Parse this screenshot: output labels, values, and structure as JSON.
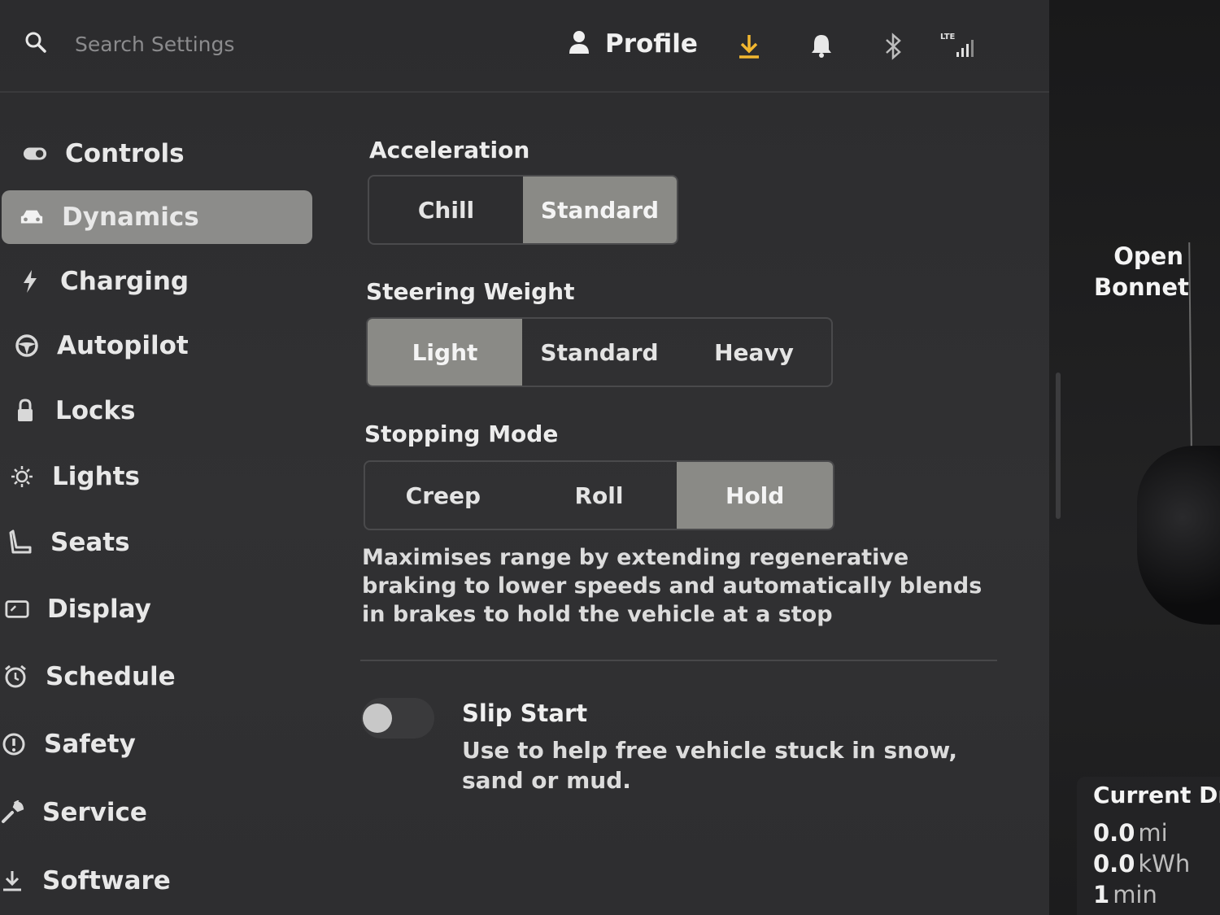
{
  "topbar": {
    "search_placeholder": "Search Settings",
    "profile_label": "Profile",
    "download_color": "#f2b730",
    "icons": [
      "search-icon",
      "person-icon",
      "download-icon",
      "bell-icon",
      "bluetooth-icon",
      "signal-icon"
    ],
    "network_label": "LTE"
  },
  "sidebar": {
    "items": [
      {
        "label": "Controls",
        "icon": "toggle-icon"
      },
      {
        "label": "Dynamics",
        "icon": "car-icon",
        "active": true
      },
      {
        "label": "Charging",
        "icon": "lightning-icon"
      },
      {
        "label": "Autopilot",
        "icon": "steering-wheel-icon"
      },
      {
        "label": "Locks",
        "icon": "lock-icon"
      },
      {
        "label": "Lights",
        "icon": "sun-icon"
      },
      {
        "label": "Seats",
        "icon": "seat-icon"
      },
      {
        "label": "Display",
        "icon": "display-icon"
      },
      {
        "label": "Schedule",
        "icon": "alarm-clock-icon"
      },
      {
        "label": "Safety",
        "icon": "alert-circle-icon"
      },
      {
        "label": "Service",
        "icon": "wrench-icon"
      },
      {
        "label": "Software",
        "icon": "download-icon"
      }
    ]
  },
  "acceleration": {
    "title": "Acceleration",
    "options": [
      "Chill",
      "Standard"
    ],
    "selected": "Standard"
  },
  "steering_weight": {
    "title": "Steering Weight",
    "options": [
      "Light",
      "Standard",
      "Heavy"
    ],
    "selected": "Light"
  },
  "stopping_mode": {
    "title": "Stopping Mode",
    "options": [
      "Creep",
      "Roll",
      "Hold"
    ],
    "selected": "Hold",
    "description": "Maximises range by extending regenerative braking to lower speeds and automatically blends in brakes to hold the vehicle at a stop"
  },
  "slip_start": {
    "title": "Slip Start",
    "description": "Use to help free vehicle stuck in snow, sand or mud.",
    "enabled": false
  },
  "car_view": {
    "open_bonnet": "Open Bonnet"
  },
  "current_drive": {
    "title": "Current Drive",
    "distance_value": "0.0",
    "distance_unit": "mi",
    "energy_value": "0.0",
    "energy_unit": "kWh",
    "time_value": "1",
    "time_unit": "min"
  }
}
